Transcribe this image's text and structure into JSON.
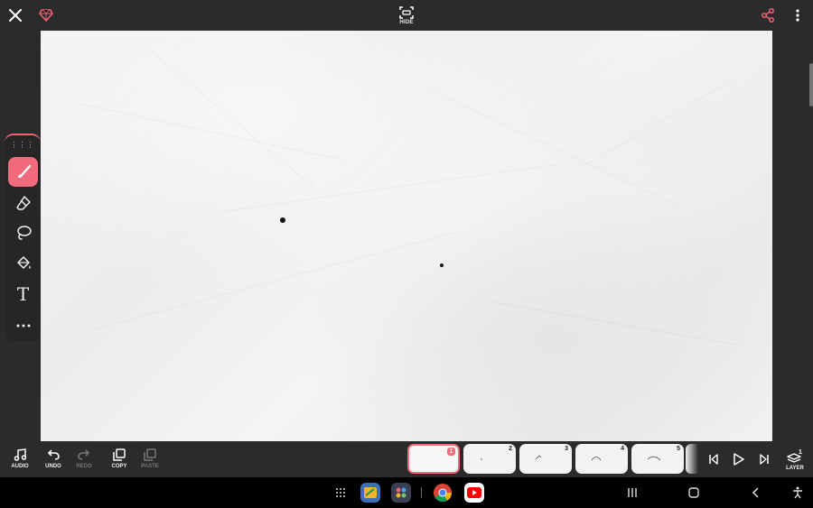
{
  "topbar": {
    "hide_label": "HIDE",
    "icons": [
      "close-icon",
      "gem-icon",
      "hide-frame-icon",
      "share-icon",
      "more-vert-icon"
    ],
    "accent_color": "#f06173"
  },
  "tools": {
    "icons": [
      "drag-grip-icon",
      "brush-icon",
      "eraser-icon",
      "lasso-icon",
      "paint-bucket-icon",
      "text-tool-icon",
      "more-horiz-icon"
    ],
    "text_tool_glyph": "T",
    "active_tool": "brush",
    "active_color": "#f26b7c"
  },
  "canvas": {
    "background": "crumpled white paper"
  },
  "bottombar": {
    "audio_label": "AUDIO",
    "undo_label": "UNDO",
    "redo_label": "REDO",
    "copy_label": "COPY",
    "paste_label": "PASTE",
    "layer_label": "LAYER",
    "layer_count": "1"
  },
  "frames": [
    {
      "num": "1",
      "selected": true
    },
    {
      "num": "2",
      "selected": false
    },
    {
      "num": "3",
      "selected": false
    },
    {
      "num": "4",
      "selected": false
    },
    {
      "num": "5",
      "selected": false
    }
  ],
  "playback": {
    "icons": [
      "skip-to-start-icon",
      "play-icon",
      "skip-to-end-icon"
    ]
  },
  "navbar": {
    "icons": [
      "app-drawer-icon",
      "notes-app-icon",
      "folder-apps-icon",
      "chrome-icon",
      "youtube-icon",
      "recents-icon",
      "home-icon",
      "back-icon",
      "accessibility-icon"
    ]
  }
}
